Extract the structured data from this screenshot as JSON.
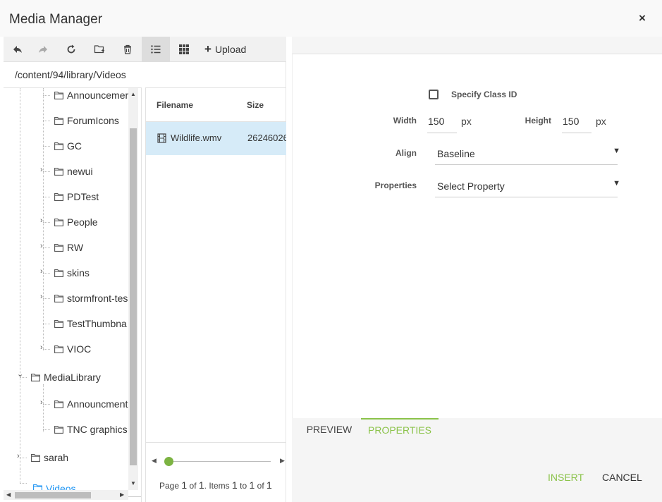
{
  "dialog": {
    "title": "Media Manager",
    "close_glyph": "×"
  },
  "toolbar": {
    "buttons": [
      {
        "name": "back-button",
        "icon": "back-arrow-icon"
      },
      {
        "name": "forward-button",
        "icon": "forward-arrow-icon"
      },
      {
        "name": "refresh-button",
        "icon": "refresh-icon"
      },
      {
        "name": "new-folder-button",
        "icon": "new-folder-icon"
      },
      {
        "name": "delete-button",
        "icon": "trash-icon"
      },
      {
        "name": "list-view-button",
        "icon": "list-icon"
      },
      {
        "name": "grid-view-button",
        "icon": "grid-icon"
      }
    ],
    "upload_label": "Upload"
  },
  "path": "/content/94/library/Videos",
  "tree": {
    "items": [
      {
        "label": "Announcemer",
        "expandable": false
      },
      {
        "label": "ForumIcons",
        "expandable": false
      },
      {
        "label": "GC",
        "expandable": false
      },
      {
        "label": "newui",
        "expandable": true
      },
      {
        "label": "PDTest",
        "expandable": false
      },
      {
        "label": "People",
        "expandable": true
      },
      {
        "label": "RW",
        "expandable": true
      },
      {
        "label": "skins",
        "expandable": true
      },
      {
        "label": "stormfront-tes",
        "expandable": true
      },
      {
        "label": "TestThumbna",
        "expandable": false
      },
      {
        "label": "VIOC",
        "expandable": true
      },
      {
        "label": "MediaLibrary",
        "expanded": true
      },
      {
        "label": "Announcment",
        "expandable": true
      },
      {
        "label": "TNC graphics",
        "expandable": false
      },
      {
        "label": "sarah",
        "expandable": true
      },
      {
        "label": "Videos",
        "selected": true
      }
    ]
  },
  "files": {
    "columns": [
      "Filename",
      "Size"
    ],
    "rows": [
      {
        "filename": "Wildlife.wmv",
        "size": "26246026"
      }
    ],
    "pager": {
      "page_label": "Page",
      "page": "1",
      "of_label": "of",
      "pages": "1",
      "items_label": ". Items",
      "from": "1",
      "to_label": "to",
      "to": "1",
      "total_of_label": "of",
      "total": "1"
    }
  },
  "properties": {
    "specify_class_id_label": "Specify Class ID",
    "width_label": "Width",
    "width_value": "150",
    "height_label": "Height",
    "height_value": "150",
    "unit": "px",
    "align_label": "Align",
    "align_value": "Baseline",
    "properties_label": "Properties",
    "properties_value": "Select Property"
  },
  "tabs": {
    "preview": "PREVIEW",
    "properties": "PROPERTIES"
  },
  "actions": {
    "insert": "INSERT",
    "cancel": "CANCEL"
  },
  "colors": {
    "accent": "#8bc34a",
    "selected_row": "#d6ebf8",
    "selected_node": "#2196f3"
  }
}
